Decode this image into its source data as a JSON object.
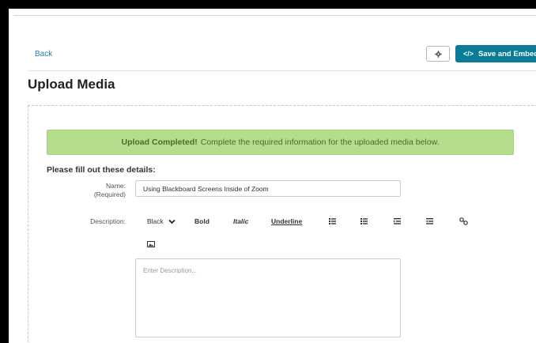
{
  "nav": {
    "back_label": "Back"
  },
  "toolbar": {
    "settings_icon": "gear-icon",
    "save_icon": "code-icon",
    "save_label": "Save and Embed"
  },
  "page": {
    "title": "Upload Media"
  },
  "alert": {
    "bold": "Upload Completed!",
    "text": "Complete the required information for the uploaded media below.",
    "color": "#b6dd8e"
  },
  "form": {
    "heading": "Please fill out these details:",
    "name_label": "Name:",
    "name_required": "(Required)",
    "name_value": "Using Blackboard Screens Inside of Zoom",
    "description_label": "Description:",
    "description_placeholder": "Enter Description..."
  },
  "editor": {
    "color_value": "Black",
    "bold": "Bold",
    "italic": "Italic",
    "underline": "Underline"
  },
  "colors": {
    "accent": "#0b7c97",
    "link": "#2a7ab0"
  }
}
